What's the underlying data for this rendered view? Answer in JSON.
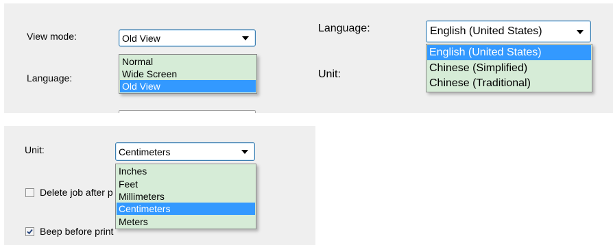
{
  "panel1": {
    "view_mode_label": "View mode:",
    "view_mode_value": "Old View",
    "view_mode_options": [
      "Normal",
      "Wide Screen",
      "Old View"
    ],
    "view_mode_selected": 2,
    "language_label": "Language:"
  },
  "panel2": {
    "language_label": "Language:",
    "language_value": "English (United States)",
    "language_options": [
      "English (United States)",
      "Chinese (Simplified)",
      "Chinese (Traditional)"
    ],
    "language_selected": 0,
    "unit_label": "Unit:"
  },
  "panel3": {
    "unit_label": "Unit:",
    "unit_value": "Centimeters",
    "unit_options": [
      "Inches",
      "Feet",
      "Millimeters",
      "Centimeters",
      "Meters"
    ],
    "unit_selected": 3,
    "delete_job_label": "Delete job after p",
    "delete_job_checked": false,
    "beep_label": "Beep before print",
    "beep_checked": true
  },
  "colors": {
    "panel_bg": "#efefef",
    "dropdown_bg": "#d6ecd7",
    "selection": "#3399ff",
    "combo_border": "#3c7fb1"
  },
  "icons": {
    "dropdown_arrow": "chevron-down-icon",
    "checkmark": "checkmark-icon"
  }
}
